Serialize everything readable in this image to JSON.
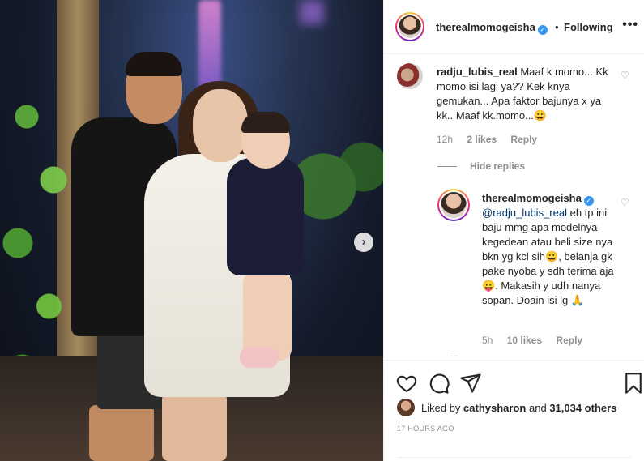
{
  "post": {
    "author": "therealmomogeisha",
    "follow_state": "Following",
    "separator": "•",
    "more_label": "•••",
    "next_arrow": "›"
  },
  "comments": [
    {
      "username": "radju_lubis_real",
      "text": "Maaf k momo... Kk momo isi lagi ya?? Kek knya gemukan... Apa faktor bajunya x ya kk.. Maaf kk.momo...😀",
      "time": "12h",
      "likes": "2 likes",
      "reply_label": "Reply"
    }
  ],
  "hide_replies": "Hide replies",
  "reply": {
    "username": "therealmomogeisha",
    "mention": "@radju_lubis_real",
    "text": " eh tp ini baju mmg apa modelnya kegedean atau beli size nya bkn yg kcl sih😀, belanja gk pake nyoba y sdh terima aja 😛. Makasih y udh nanya sopan. Doain isi lg 🙏",
    "time": "5h",
    "likes": "10 likes",
    "reply_label": "Reply"
  },
  "likes_summary": {
    "prefix": "Liked by ",
    "user": "cathysharon",
    "middle": " and ",
    "count": "31,034 others"
  },
  "timestamp": "17 HOURS AGO",
  "icons": {
    "verified": "✓",
    "heart_small": "♡"
  },
  "colors": {
    "text": "#262626",
    "secondary": "#8e8e8e",
    "verified": "#3897f0",
    "mention": "#00376b"
  }
}
